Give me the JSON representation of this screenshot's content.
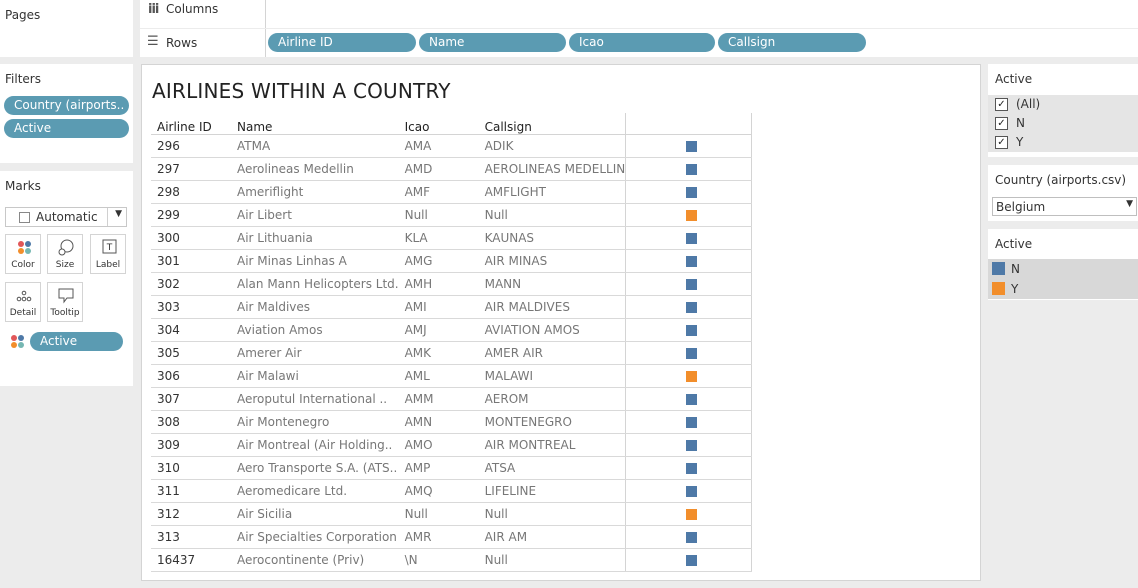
{
  "pages": {
    "title": "Pages"
  },
  "filters": {
    "title": "Filters",
    "pills": [
      "Country (airports..",
      "Active"
    ]
  },
  "marks": {
    "title": "Marks",
    "type_label": "Automatic",
    "buttons": {
      "color": "Color",
      "size": "Size",
      "label": "Label",
      "detail": "Detail",
      "tooltip": "Tooltip"
    },
    "color_pill": "Active"
  },
  "shelves": {
    "columns_label": "Columns",
    "rows_label": "Rows",
    "rows_pills": [
      "Airline ID",
      "Name",
      "Icao",
      "Callsign"
    ]
  },
  "sheet": {
    "title": "AIRLINES WITHIN A COUNTRY",
    "headers": [
      "Airline ID",
      "Name",
      "Icao",
      "Callsign"
    ],
    "rows": [
      {
        "id": "296",
        "name": "ATMA",
        "icao": "AMA",
        "callsign": "ADIK",
        "active": "N"
      },
      {
        "id": "297",
        "name": "Aerolineas Medellin",
        "icao": "AMD",
        "callsign": "AEROLINEAS MEDELLIN",
        "active": "N"
      },
      {
        "id": "298",
        "name": "Ameriflight",
        "icao": "AMF",
        "callsign": "AMFLIGHT",
        "active": "N"
      },
      {
        "id": "299",
        "name": "Air Libert",
        "icao": "Null",
        "callsign": "Null",
        "active": "Y"
      },
      {
        "id": "300",
        "name": "Air Lithuania",
        "icao": "KLA",
        "callsign": "KAUNAS",
        "active": "N"
      },
      {
        "id": "301",
        "name": "Air Minas Linhas A",
        "icao": "AMG",
        "callsign": "AIR MINAS",
        "active": "N"
      },
      {
        "id": "302",
        "name": "Alan Mann Helicopters Ltd.",
        "icao": "AMH",
        "callsign": "MANN",
        "active": "N"
      },
      {
        "id": "303",
        "name": "Air Maldives",
        "icao": "AMI",
        "callsign": "AIR MALDIVES",
        "active": "N"
      },
      {
        "id": "304",
        "name": "Aviation Amos",
        "icao": "AMJ",
        "callsign": "AVIATION AMOS",
        "active": "N"
      },
      {
        "id": "305",
        "name": "Amerer Air",
        "icao": "AMK",
        "callsign": "AMER AIR",
        "active": "N"
      },
      {
        "id": "306",
        "name": "Air Malawi",
        "icao": "AML",
        "callsign": "MALAWI",
        "active": "Y"
      },
      {
        "id": "307",
        "name": "Aeroputul International ..",
        "icao": "AMM",
        "callsign": "AEROM",
        "active": "N"
      },
      {
        "id": "308",
        "name": "Air Montenegro",
        "icao": "AMN",
        "callsign": "MONTENEGRO",
        "active": "N"
      },
      {
        "id": "309",
        "name": "Air Montreal (Air Holding..",
        "icao": "AMO",
        "callsign": "AIR MONTREAL",
        "active": "N"
      },
      {
        "id": "310",
        "name": "Aero Transporte S.A. (ATS..",
        "icao": "AMP",
        "callsign": "ATSA",
        "active": "N"
      },
      {
        "id": "311",
        "name": "Aeromedicare Ltd.",
        "icao": "AMQ",
        "callsign": "LIFELINE",
        "active": "N"
      },
      {
        "id": "312",
        "name": "Air Sicilia",
        "icao": "Null",
        "callsign": "Null",
        "active": "Y"
      },
      {
        "id": "313",
        "name": "Air Specialties Corporation",
        "icao": "AMR",
        "callsign": "AIR AM",
        "active": "N"
      },
      {
        "id": "16437",
        "name": "Aerocontinente (Priv)",
        "icao": "\\N",
        "callsign": "Null",
        "active": "N"
      }
    ]
  },
  "active_filter": {
    "title": "Active",
    "options": [
      {
        "label": "(All)",
        "checked": true
      },
      {
        "label": "N",
        "checked": true
      },
      {
        "label": "Y",
        "checked": true
      }
    ]
  },
  "country_filter": {
    "title": "Country (airports.csv)",
    "selected": "Belgium"
  },
  "legend": {
    "title": "Active",
    "items": [
      {
        "label": "N",
        "color": "#4e79a7"
      },
      {
        "label": "Y",
        "color": "#f28e2b"
      }
    ]
  },
  "colors": {
    "N": "#4e79a7",
    "Y": "#f28e2b",
    "pill": "#5b9bb2"
  }
}
